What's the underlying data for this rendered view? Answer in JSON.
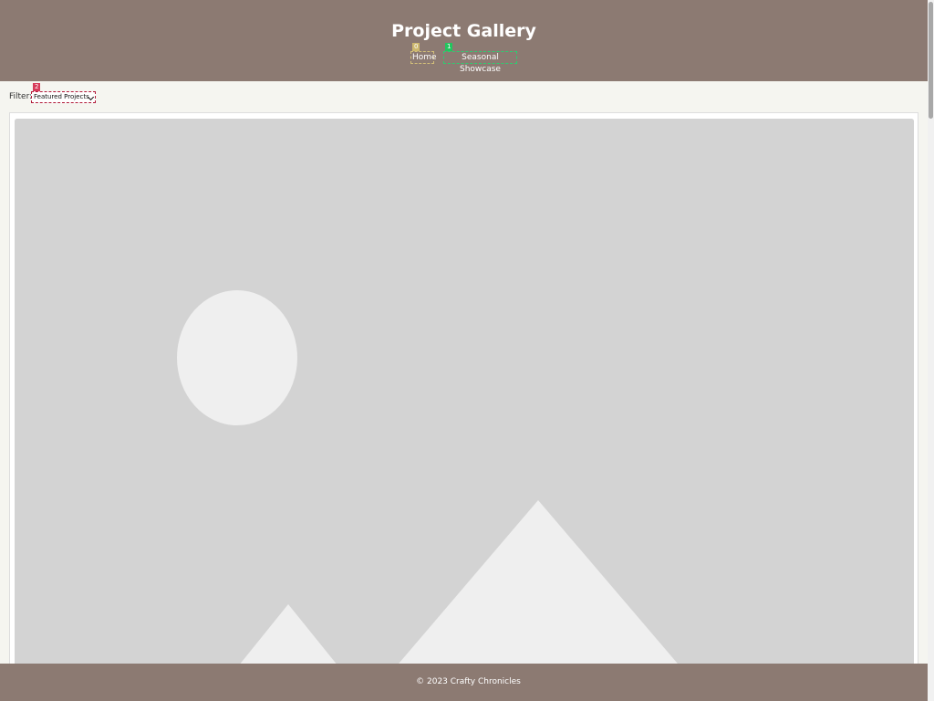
{
  "header": {
    "title": "Project Gallery",
    "nav": [
      {
        "label": "Home",
        "marker": "0"
      },
      {
        "label": "Seasonal Showcase",
        "marker": "1"
      }
    ]
  },
  "filter": {
    "label": "Filter:",
    "marker": "2",
    "selected": "Featured Projects"
  },
  "gallery": {
    "image_icon": "image-placeholder-icon"
  },
  "footer": {
    "text": "© 2023 Crafty Chronicles"
  },
  "colors": {
    "header_bg": "#8c7a72",
    "page_bg": "#f5f5f0",
    "placeholder_bg": "#d3d3d3"
  }
}
